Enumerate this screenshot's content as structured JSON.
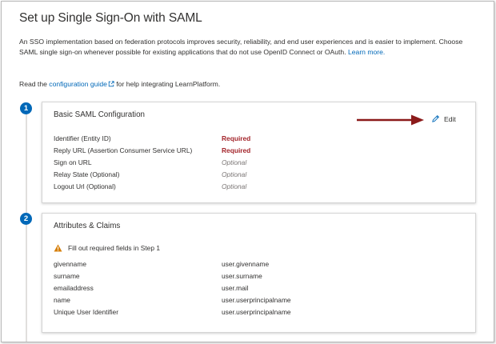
{
  "page": {
    "title": "Set up Single Sign-On with SAML",
    "intro_text": "An SSO implementation based on federation protocols improves security, reliability, and end user experiences and is easier to implement. Choose SAML single sign-on whenever possible for existing applications that do not use OpenID Connect or OAuth.",
    "intro_link": "Learn more.",
    "read_prefix": "Read the",
    "read_link": "configuration guide",
    "read_suffix": "for help integrating LearnPlatform."
  },
  "steps": [
    {
      "number": "1",
      "title": "Basic SAML Configuration",
      "edit_label": "Edit",
      "rows": [
        {
          "label": "Identifier (Entity ID)",
          "value": "Required",
          "status": "required"
        },
        {
          "label": "Reply URL (Assertion Consumer Service URL)",
          "value": "Required",
          "status": "required"
        },
        {
          "label": "Sign on URL",
          "value": "Optional",
          "status": "optional"
        },
        {
          "label": "Relay State (Optional)",
          "value": "Optional",
          "status": "optional"
        },
        {
          "label": "Logout Url (Optional)",
          "value": "Optional",
          "status": "optional"
        }
      ]
    },
    {
      "number": "2",
      "title": "Attributes & Claims",
      "warning": "Fill out required fields in Step 1",
      "rows": [
        {
          "label": "givenname",
          "value": "user.givenname"
        },
        {
          "label": "surname",
          "value": "user.surname"
        },
        {
          "label": "emailaddress",
          "value": "user.mail"
        },
        {
          "label": "name",
          "value": "user.userprincipalname"
        },
        {
          "label": "Unique User Identifier",
          "value": "user.userprincipalname"
        }
      ]
    }
  ],
  "colors": {
    "accent": "#0068b8",
    "required": "#a4262c",
    "optional": "#7a7574",
    "warning": "#d67f0b",
    "annotation_arrow": "#8b1a1a"
  },
  "icons": {
    "external_link": "external-link-icon",
    "edit": "pencil-icon",
    "warning": "warning-triangle-icon",
    "annotation": "arrow-right-icon"
  }
}
